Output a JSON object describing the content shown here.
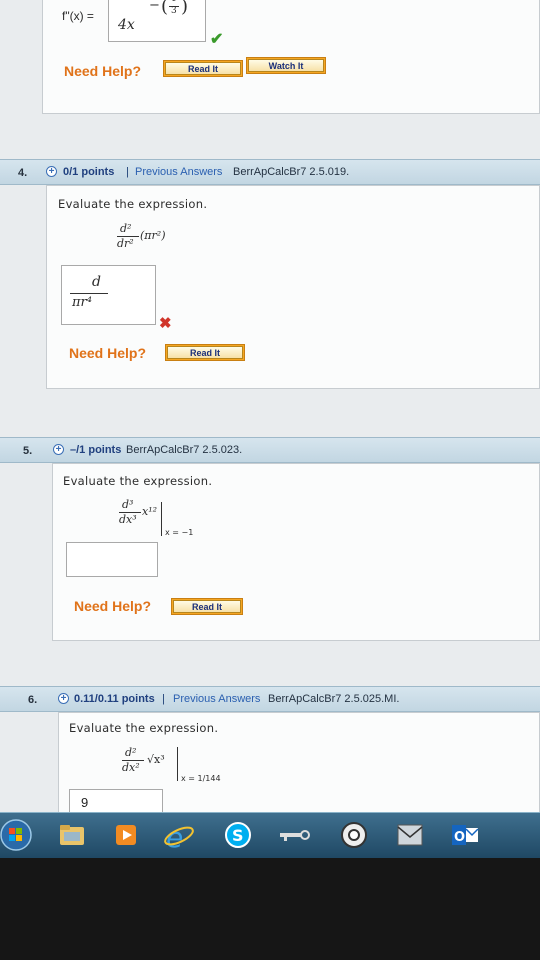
{
  "q3": {
    "answer_label": "f\"(x) =",
    "answer_value": "4x",
    "exponent": "−(1/3)",
    "exp_num": "1",
    "exp_den": "3",
    "help_label": "Need Help?",
    "read_label": "Read It",
    "watch_label": "Watch It"
  },
  "q4": {
    "number": "4.",
    "points": "0/1 points",
    "separator": "|",
    "previous_answers": "Previous Answers",
    "problem_id": "BerrApCalcBr7 2.5.019.",
    "prompt": "Evaluate the expression.",
    "expr_num": "d²",
    "expr_den": "dr²",
    "expr_body": "(πr²)",
    "answer_num": "d",
    "answer_den": "πr⁴",
    "help_label": "Need Help?",
    "read_label": "Read It"
  },
  "q5": {
    "number": "5.",
    "points": "–/1 points",
    "problem_id": "BerrApCalcBr7 2.5.023.",
    "prompt": "Evaluate the expression.",
    "expr_num": "d³",
    "expr_den": "dx³",
    "expr_body": "x¹²",
    "eval_at": "x = −1",
    "help_label": "Need Help?",
    "read_label": "Read It"
  },
  "q6": {
    "number": "6.",
    "points": "0.11/0.11 points",
    "separator": "|",
    "previous_answers": "Previous Answers",
    "problem_id": "BerrApCalcBr7 2.5.025.MI.",
    "prompt": "Evaluate the expression.",
    "expr_num": "d²",
    "expr_den": "dx²",
    "expr_body": "√x³",
    "eval_at": "x = 1/144",
    "answer_value": "9"
  },
  "taskbar": {
    "icons": [
      "start-orb-icon",
      "file-explorer-icon",
      "media-player-icon",
      "internet-explorer-icon",
      "skype-icon",
      "network-key-icon",
      "chrome-icon",
      "mail-icon",
      "outlook-icon"
    ]
  },
  "colors": {
    "header_bg": "#c9dbe6",
    "help_text": "#e0731a",
    "button_orange": "#f5a623",
    "link_blue": "#2a5fb0",
    "check_green": "#3a9a2b",
    "x_red": "#d0352a"
  }
}
